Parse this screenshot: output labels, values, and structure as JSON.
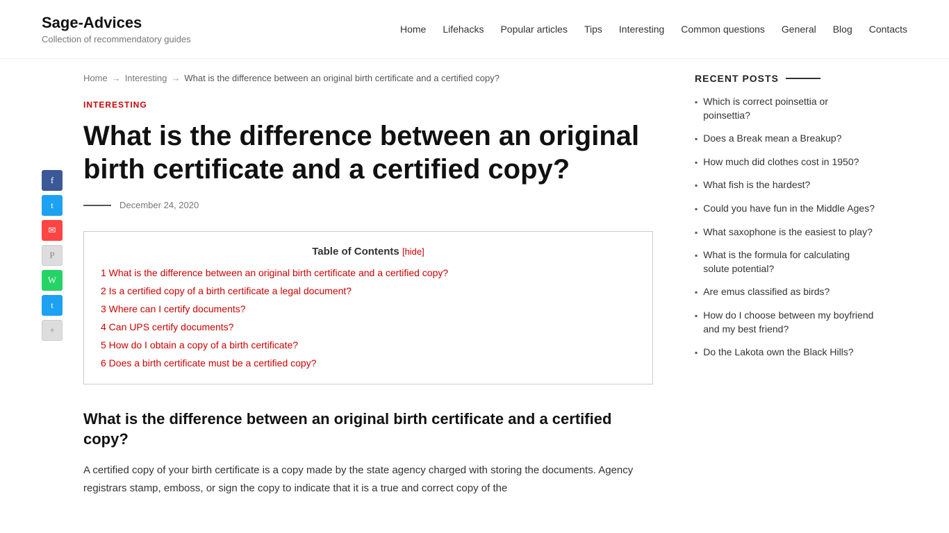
{
  "site": {
    "title": "Sage-Advices",
    "tagline": "Collection of recommendatory guides"
  },
  "nav": {
    "items": [
      {
        "label": "Home",
        "href": "#"
      },
      {
        "label": "Lifehacks",
        "href": "#"
      },
      {
        "label": "Popular articles",
        "href": "#"
      },
      {
        "label": "Tips",
        "href": "#"
      },
      {
        "label": "Interesting",
        "href": "#"
      },
      {
        "label": "Common questions",
        "href": "#"
      },
      {
        "label": "General",
        "href": "#"
      },
      {
        "label": "Blog",
        "href": "#"
      },
      {
        "label": "Contacts",
        "href": "#"
      }
    ]
  },
  "breadcrumb": {
    "home": "Home",
    "category": "Interesting",
    "current": "What is the difference between an original birth certificate and a certified copy?"
  },
  "article": {
    "category": "INTERESTING",
    "title": "What is the difference between an original birth certificate and a certified copy?",
    "date": "December 24, 2020",
    "toc_title": "Table of Contents",
    "toc_hide": "[hide]",
    "toc_items": [
      {
        "num": "1",
        "text": "What is the difference between an original birth certificate and a certified copy?"
      },
      {
        "num": "2",
        "text": "Is a certified copy of a birth certificate a legal document?"
      },
      {
        "num": "3",
        "text": "Where can I certify documents?"
      },
      {
        "num": "4",
        "text": "Can UPS certify documents?"
      },
      {
        "num": "5",
        "text": "How do I obtain a copy of a birth certificate?"
      },
      {
        "num": "6",
        "text": "Does a birth certificate must be a certified copy?"
      }
    ],
    "section1_heading": "What is the difference between an original birth certificate and a certified copy?",
    "body_text1": "A certified copy of your birth certificate is a copy made by the state agency charged with storing the documents. Agency registrars stamp, emboss, or sign the copy to indicate that it is a true and correct copy of the"
  },
  "sidebar": {
    "recent_posts_title": "RECENT POSTS",
    "posts": [
      {
        "text": "Which is correct poinsettia or poinsettia?"
      },
      {
        "text": "Does a Break mean a Breakup?"
      },
      {
        "text": "How much did clothes cost in 1950?"
      },
      {
        "text": "What fish is the hardest?"
      },
      {
        "text": "Could you have fun in the Middle Ages?"
      },
      {
        "text": "What saxophone is the easiest to play?"
      },
      {
        "text": "What is the formula for calculating solute potential?"
      },
      {
        "text": "Are emus classified as birds?"
      },
      {
        "text": "How do I choose between my boyfriend and my best friend?"
      },
      {
        "text": "Do the Lakota own the Black Hills?"
      }
    ]
  },
  "social": {
    "buttons": [
      {
        "name": "facebook",
        "label": "f",
        "class": "social-fb"
      },
      {
        "name": "twitter",
        "label": "t",
        "class": "social-tw"
      },
      {
        "name": "email",
        "label": "✉",
        "class": "social-em"
      },
      {
        "name": "pinterest",
        "label": "P",
        "class": "social-pin"
      },
      {
        "name": "whatsapp",
        "label": "W",
        "class": "social-wa"
      },
      {
        "name": "twitter2",
        "label": "t",
        "class": "social-tw2"
      },
      {
        "name": "share",
        "label": "+",
        "class": "social-share"
      }
    ]
  }
}
